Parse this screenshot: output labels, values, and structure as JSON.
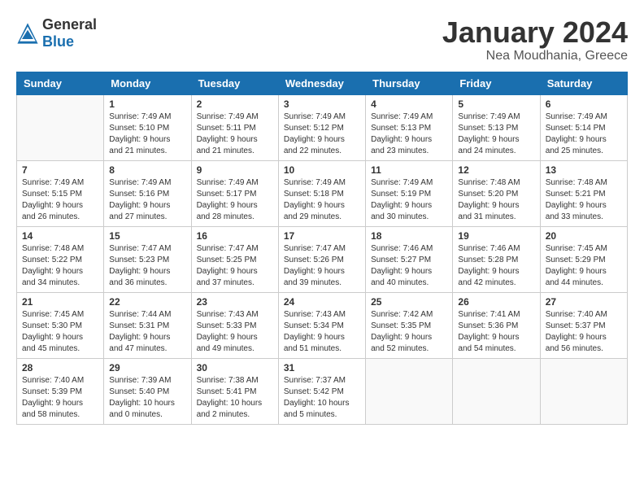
{
  "header": {
    "logo_general": "General",
    "logo_blue": "Blue",
    "month": "January 2024",
    "location": "Nea Moudhania, Greece"
  },
  "weekdays": [
    "Sunday",
    "Monday",
    "Tuesday",
    "Wednesday",
    "Thursday",
    "Friday",
    "Saturday"
  ],
  "weeks": [
    [
      {
        "day": "",
        "sunrise": "",
        "sunset": "",
        "daylight": ""
      },
      {
        "day": "1",
        "sunrise": "Sunrise: 7:49 AM",
        "sunset": "Sunset: 5:10 PM",
        "daylight": "Daylight: 9 hours and 21 minutes."
      },
      {
        "day": "2",
        "sunrise": "Sunrise: 7:49 AM",
        "sunset": "Sunset: 5:11 PM",
        "daylight": "Daylight: 9 hours and 21 minutes."
      },
      {
        "day": "3",
        "sunrise": "Sunrise: 7:49 AM",
        "sunset": "Sunset: 5:12 PM",
        "daylight": "Daylight: 9 hours and 22 minutes."
      },
      {
        "day": "4",
        "sunrise": "Sunrise: 7:49 AM",
        "sunset": "Sunset: 5:13 PM",
        "daylight": "Daylight: 9 hours and 23 minutes."
      },
      {
        "day": "5",
        "sunrise": "Sunrise: 7:49 AM",
        "sunset": "Sunset: 5:13 PM",
        "daylight": "Daylight: 9 hours and 24 minutes."
      },
      {
        "day": "6",
        "sunrise": "Sunrise: 7:49 AM",
        "sunset": "Sunset: 5:14 PM",
        "daylight": "Daylight: 9 hours and 25 minutes."
      }
    ],
    [
      {
        "day": "7",
        "sunrise": "Sunrise: 7:49 AM",
        "sunset": "Sunset: 5:15 PM",
        "daylight": "Daylight: 9 hours and 26 minutes."
      },
      {
        "day": "8",
        "sunrise": "Sunrise: 7:49 AM",
        "sunset": "Sunset: 5:16 PM",
        "daylight": "Daylight: 9 hours and 27 minutes."
      },
      {
        "day": "9",
        "sunrise": "Sunrise: 7:49 AM",
        "sunset": "Sunset: 5:17 PM",
        "daylight": "Daylight: 9 hours and 28 minutes."
      },
      {
        "day": "10",
        "sunrise": "Sunrise: 7:49 AM",
        "sunset": "Sunset: 5:18 PM",
        "daylight": "Daylight: 9 hours and 29 minutes."
      },
      {
        "day": "11",
        "sunrise": "Sunrise: 7:49 AM",
        "sunset": "Sunset: 5:19 PM",
        "daylight": "Daylight: 9 hours and 30 minutes."
      },
      {
        "day": "12",
        "sunrise": "Sunrise: 7:48 AM",
        "sunset": "Sunset: 5:20 PM",
        "daylight": "Daylight: 9 hours and 31 minutes."
      },
      {
        "day": "13",
        "sunrise": "Sunrise: 7:48 AM",
        "sunset": "Sunset: 5:21 PM",
        "daylight": "Daylight: 9 hours and 33 minutes."
      }
    ],
    [
      {
        "day": "14",
        "sunrise": "Sunrise: 7:48 AM",
        "sunset": "Sunset: 5:22 PM",
        "daylight": "Daylight: 9 hours and 34 minutes."
      },
      {
        "day": "15",
        "sunrise": "Sunrise: 7:47 AM",
        "sunset": "Sunset: 5:23 PM",
        "daylight": "Daylight: 9 hours and 36 minutes."
      },
      {
        "day": "16",
        "sunrise": "Sunrise: 7:47 AM",
        "sunset": "Sunset: 5:25 PM",
        "daylight": "Daylight: 9 hours and 37 minutes."
      },
      {
        "day": "17",
        "sunrise": "Sunrise: 7:47 AM",
        "sunset": "Sunset: 5:26 PM",
        "daylight": "Daylight: 9 hours and 39 minutes."
      },
      {
        "day": "18",
        "sunrise": "Sunrise: 7:46 AM",
        "sunset": "Sunset: 5:27 PM",
        "daylight": "Daylight: 9 hours and 40 minutes."
      },
      {
        "day": "19",
        "sunrise": "Sunrise: 7:46 AM",
        "sunset": "Sunset: 5:28 PM",
        "daylight": "Daylight: 9 hours and 42 minutes."
      },
      {
        "day": "20",
        "sunrise": "Sunrise: 7:45 AM",
        "sunset": "Sunset: 5:29 PM",
        "daylight": "Daylight: 9 hours and 44 minutes."
      }
    ],
    [
      {
        "day": "21",
        "sunrise": "Sunrise: 7:45 AM",
        "sunset": "Sunset: 5:30 PM",
        "daylight": "Daylight: 9 hours and 45 minutes."
      },
      {
        "day": "22",
        "sunrise": "Sunrise: 7:44 AM",
        "sunset": "Sunset: 5:31 PM",
        "daylight": "Daylight: 9 hours and 47 minutes."
      },
      {
        "day": "23",
        "sunrise": "Sunrise: 7:43 AM",
        "sunset": "Sunset: 5:33 PM",
        "daylight": "Daylight: 9 hours and 49 minutes."
      },
      {
        "day": "24",
        "sunrise": "Sunrise: 7:43 AM",
        "sunset": "Sunset: 5:34 PM",
        "daylight": "Daylight: 9 hours and 51 minutes."
      },
      {
        "day": "25",
        "sunrise": "Sunrise: 7:42 AM",
        "sunset": "Sunset: 5:35 PM",
        "daylight": "Daylight: 9 hours and 52 minutes."
      },
      {
        "day": "26",
        "sunrise": "Sunrise: 7:41 AM",
        "sunset": "Sunset: 5:36 PM",
        "daylight": "Daylight: 9 hours and 54 minutes."
      },
      {
        "day": "27",
        "sunrise": "Sunrise: 7:40 AM",
        "sunset": "Sunset: 5:37 PM",
        "daylight": "Daylight: 9 hours and 56 minutes."
      }
    ],
    [
      {
        "day": "28",
        "sunrise": "Sunrise: 7:40 AM",
        "sunset": "Sunset: 5:39 PM",
        "daylight": "Daylight: 9 hours and 58 minutes."
      },
      {
        "day": "29",
        "sunrise": "Sunrise: 7:39 AM",
        "sunset": "Sunset: 5:40 PM",
        "daylight": "Daylight: 10 hours and 0 minutes."
      },
      {
        "day": "30",
        "sunrise": "Sunrise: 7:38 AM",
        "sunset": "Sunset: 5:41 PM",
        "daylight": "Daylight: 10 hours and 2 minutes."
      },
      {
        "day": "31",
        "sunrise": "Sunrise: 7:37 AM",
        "sunset": "Sunset: 5:42 PM",
        "daylight": "Daylight: 10 hours and 5 minutes."
      },
      {
        "day": "",
        "sunrise": "",
        "sunset": "",
        "daylight": ""
      },
      {
        "day": "",
        "sunrise": "",
        "sunset": "",
        "daylight": ""
      },
      {
        "day": "",
        "sunrise": "",
        "sunset": "",
        "daylight": ""
      }
    ]
  ]
}
